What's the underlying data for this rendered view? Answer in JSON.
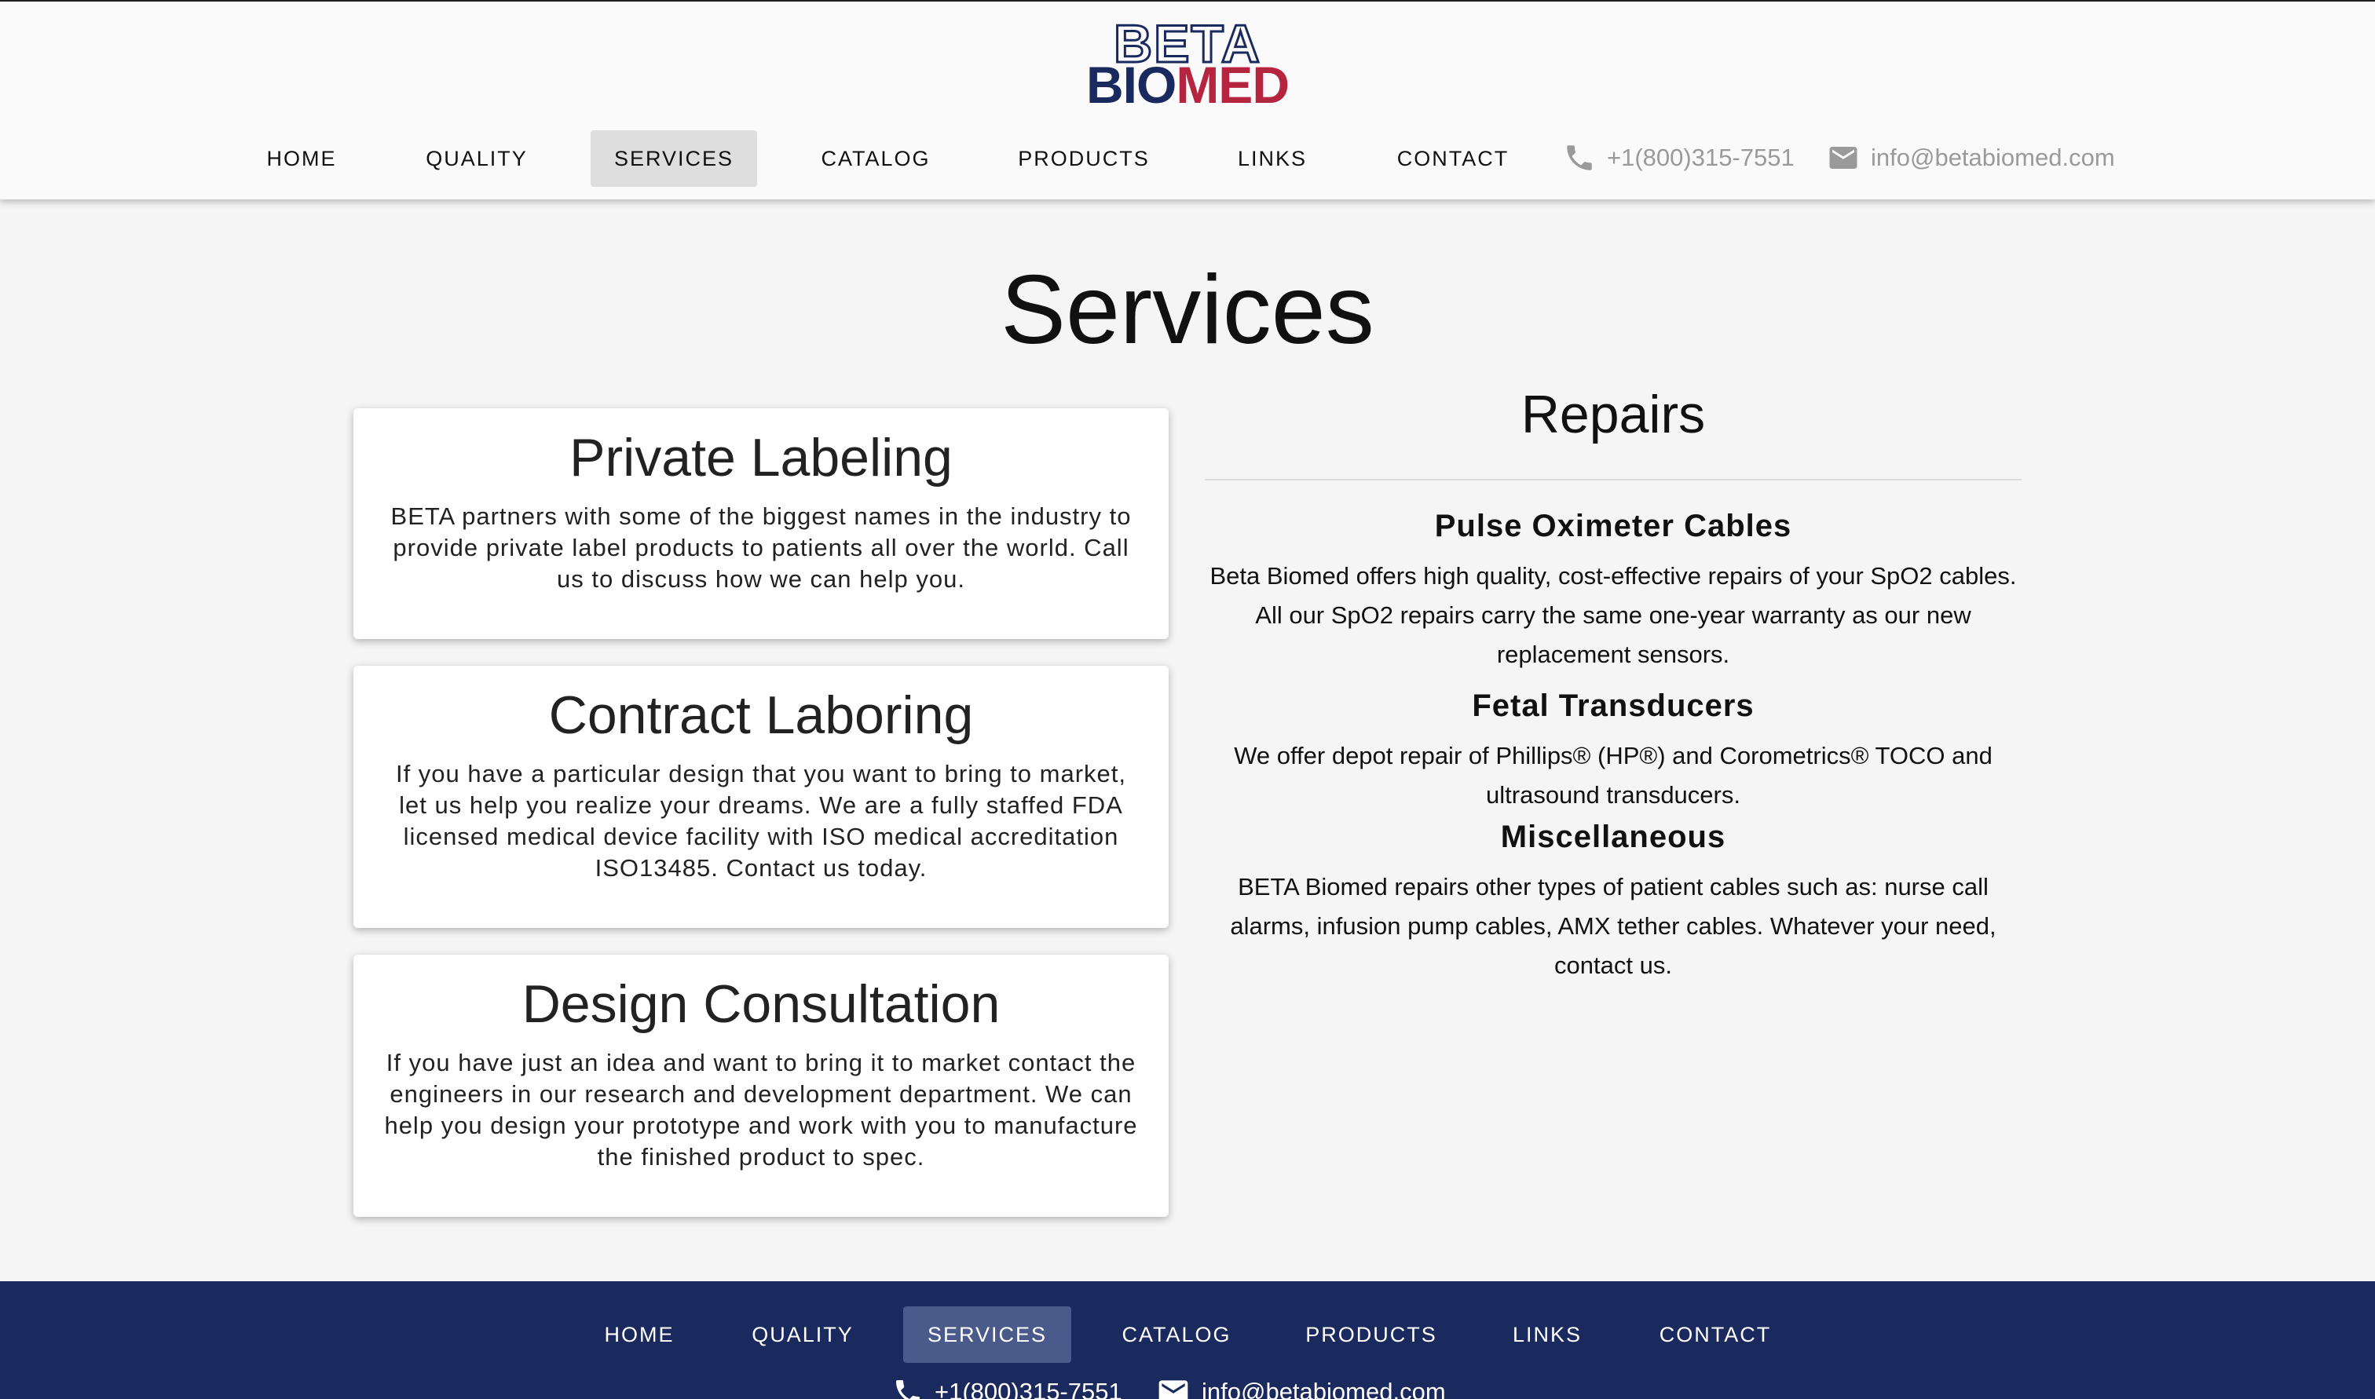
{
  "brand": {
    "line1": "BETA",
    "line2_a": "BIO",
    "line2_b": "MED"
  },
  "nav": {
    "items": [
      "HOME",
      "QUALITY",
      "SERVICES",
      "CATALOG",
      "PRODUCTS",
      "LINKS",
      "CONTACT"
    ],
    "active": "SERVICES"
  },
  "contact": {
    "phone": "+1(800)315-7551",
    "email": "info@betabiomed.com"
  },
  "page": {
    "title": "Services"
  },
  "cards": [
    {
      "title": "Private Labeling",
      "body": "BETA partners with some of the biggest names in the industry to provide private label products to patients all over the world. Call us to discuss how we can help you."
    },
    {
      "title": "Contract Laboring",
      "body": "If you have a particular design that you want to bring to market, let us help you realize your dreams. We are a fully staffed FDA licensed medical device facility with ISO medical accreditation ISO13485. Contact us today."
    },
    {
      "title": "Design Consultation",
      "body": "If you have just an idea and want to bring it to market contact the engineers in our research and development department. We can help you design your prototype and work with you to manufacture the finished product to spec."
    }
  ],
  "repairs": {
    "title": "Repairs",
    "sections": [
      {
        "heading": "Pulse Oximeter Cables",
        "body": "Beta Biomed offers high quality, cost-effective repairs of your SpO2 cables. All our SpO2 repairs carry the same one-year warranty as our new replacement sensors."
      },
      {
        "heading": "Fetal Transducers",
        "body": "We offer depot repair of Phillips® (HP®) and Corometrics® TOCO and ultrasound transducers."
      },
      {
        "heading": "Miscellaneous",
        "body": "BETA Biomed repairs other types of patient cables such as: nurse call alarms, infusion pump cables, AMX tether cables. Whatever your need, contact us."
      }
    ]
  },
  "footer": {
    "nav": [
      "HOME",
      "QUALITY",
      "SERVICES",
      "CATALOG",
      "PRODUCTS",
      "LINKS",
      "CONTACT"
    ],
    "phone": "+1(800)315-7551",
    "email": "info@betabiomed.com"
  },
  "icons": {
    "phone": "phone-icon",
    "email": "email-icon"
  },
  "colors": {
    "navy": "#1b2a5e",
    "red": "#b5253f",
    "active_nav": "#dedede",
    "muted": "#9a9a9a"
  }
}
